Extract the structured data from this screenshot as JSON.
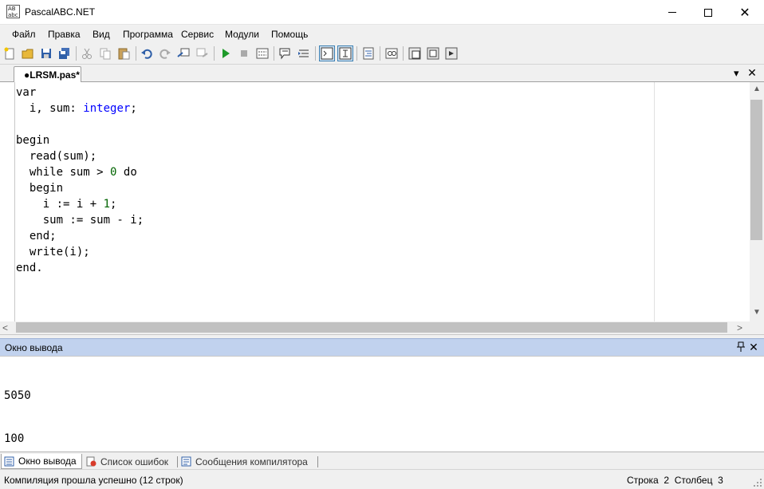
{
  "window": {
    "title": "PascalABC.NET",
    "icon_text": [
      "AB",
      "abc"
    ],
    "close_glyph": "✕"
  },
  "menu": {
    "items": [
      "Файл",
      "Правка",
      "Вид",
      "Программа",
      "Сервис",
      "Модули",
      "Помощь"
    ]
  },
  "toolbar": {
    "buttons": [
      "new-file-icon",
      "open-folder-icon",
      "save-icon",
      "save-all-icon",
      "cut-icon",
      "copy-icon",
      "paste-icon",
      "undo-icon",
      "redo-icon",
      "run-icon",
      "stop-icon",
      "debug-window-icon",
      "comment-icon",
      "uncomment-icon",
      "console-window-icon",
      "text-window-icon",
      "format-icon",
      "compile-icon",
      "debug-icon",
      "forms-icon",
      "run-config-icon"
    ]
  },
  "tabs": {
    "file_tab": "●LRSM.pas*",
    "menu_glyph": "▾",
    "close_glyph": "✕"
  },
  "editor": {
    "lines": [
      [
        {
          "t": "var",
          "c": "kw"
        }
      ],
      [
        {
          "t": "  i, sum: ",
          "c": "id"
        },
        {
          "t": "integer",
          "c": "ty"
        },
        {
          "t": ";",
          "c": "id"
        }
      ],
      [],
      [
        {
          "t": "begin",
          "c": "kw"
        }
      ],
      [
        {
          "t": "  read(sum);",
          "c": "id"
        }
      ],
      [
        {
          "t": "  while",
          "c": "kw"
        },
        {
          "t": " sum > ",
          "c": "id"
        },
        {
          "t": "0",
          "c": "num"
        },
        {
          "t": " do",
          "c": "kw"
        }
      ],
      [
        {
          "t": "  begin",
          "c": "kw"
        }
      ],
      [
        {
          "t": "    i := i + ",
          "c": "id"
        },
        {
          "t": "1",
          "c": "num"
        },
        {
          "t": ";",
          "c": "id"
        }
      ],
      [
        {
          "t": "    sum := sum - i;",
          "c": "id"
        }
      ],
      [
        {
          "t": "  end",
          "c": "kw"
        },
        {
          "t": ";",
          "c": "id"
        }
      ],
      [
        {
          "t": "  write(i);",
          "c": "id"
        }
      ],
      [
        {
          "t": "end",
          "c": "kw"
        },
        {
          "t": ".",
          "c": "id"
        }
      ]
    ],
    "scroll_up_glyph": "▲",
    "scroll_down_glyph": "▼",
    "scroll_left_glyph": "<",
    "scroll_right_glyph": ">"
  },
  "output": {
    "title": "Окно вывода",
    "pin_glyph": "ᛘ",
    "close_glyph": "✕",
    "lines": [
      "5050",
      "100"
    ]
  },
  "bottom_tabs": [
    {
      "label": "Окно вывода",
      "icon": "output-window-icon",
      "active": true
    },
    {
      "label": "Список ошибок",
      "icon": "error-list-icon",
      "active": false
    },
    {
      "label": "Сообщения компилятора",
      "icon": "compiler-messages-icon",
      "active": false
    }
  ],
  "status": {
    "message": "Компиляция прошла успешно (12 строк)",
    "row_label": "Строка",
    "row_value": "2",
    "col_label": "Столбец",
    "col_value": "3"
  },
  "colors": {
    "output_header_bg": "#c1d2ee",
    "type_color": "#0000ff",
    "number_color": "#006400"
  }
}
